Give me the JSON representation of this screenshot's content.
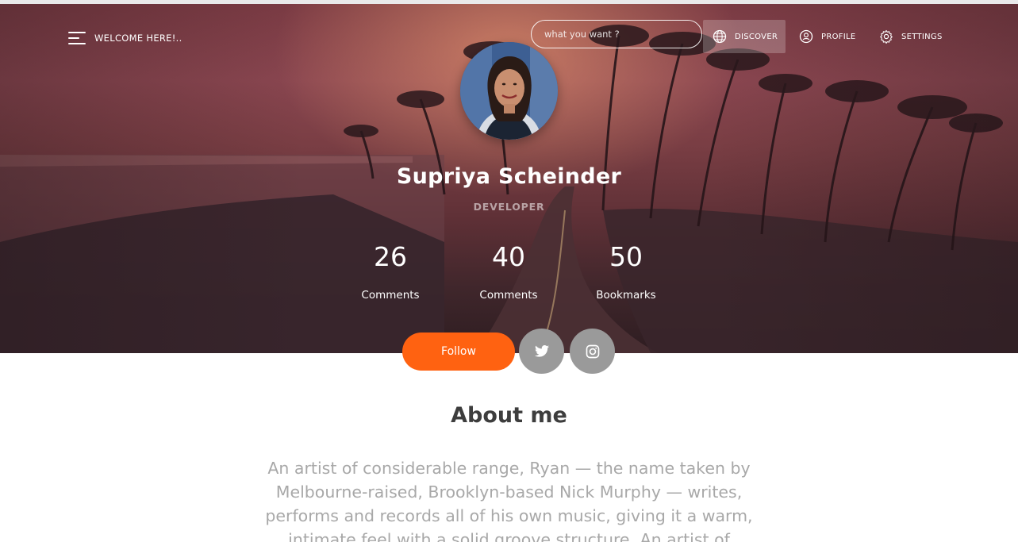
{
  "nav": {
    "welcome": "WELCOME HERE!..",
    "search_placeholder": "what you want ?",
    "items": [
      {
        "label": "DISCOVER",
        "icon": "globe-icon"
      },
      {
        "label": "PROFILE",
        "icon": "user-icon"
      },
      {
        "label": "SETTINGS",
        "icon": "gear-icon"
      }
    ]
  },
  "profile": {
    "name": "Supriya Scheinder",
    "role": "DEVELOPER",
    "stats": [
      {
        "value": "26",
        "label": "Comments"
      },
      {
        "value": "40",
        "label": "Comments"
      },
      {
        "value": "50",
        "label": "Bookmarks"
      }
    ],
    "follow_label": "Follow"
  },
  "about": {
    "title": "About me",
    "text": "An artist of considerable range, Ryan — the name taken by Melbourne-raised, Brooklyn-based Nick Murphy — writes, performs and records all of his own music, giving it a warm, intimate feel with a solid groove structure. An artist of"
  },
  "colors": {
    "accent": "#ff6211",
    "social_button": "#9a9a9a",
    "heading": "#3d3d3d",
    "body_text": "#a8a8a8"
  }
}
